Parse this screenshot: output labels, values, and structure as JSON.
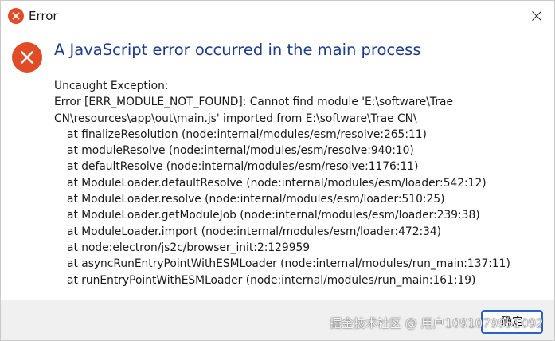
{
  "window": {
    "title": "Error"
  },
  "dialog": {
    "heading": "A JavaScript error occurred in the main process",
    "message_lines": [
      "Uncaught Exception:",
      "Error [ERR_MODULE_NOT_FOUND]: Cannot find module 'E:\\software\\Trae",
      "CN\\resources\\app\\out\\main.js' imported from E:\\software\\Trae CN\\"
    ],
    "stack_lines": [
      "at finalizeResolution (node:internal/modules/esm/resolve:265:11)",
      "at moduleResolve (node:internal/modules/esm/resolve:940:10)",
      "at defaultResolve (node:internal/modules/esm/resolve:1176:11)",
      "at ModuleLoader.defaultResolve (node:internal/modules/esm/loader:542:12)",
      "at ModuleLoader.resolve (node:internal/modules/esm/loader:510:25)",
      "at ModuleLoader.getModuleJob (node:internal/modules/esm/loader:239:38)",
      "at ModuleLoader.import (node:internal/modules/esm/loader:472:34)",
      "at node:electron/js2c/browser_init:2:129959",
      "at asyncRunEntryPointWithESMLoader (node:internal/modules/run_main:137:11)",
      "at runEntryPointWithESMLoader (node:internal/modules/run_main:161:19)"
    ],
    "ok_label": "确定"
  },
  "watermark": {
    "text": "掘金技术社区 @ 用户1091079951092"
  },
  "icons": {
    "title_icon": "error-icon",
    "dialog_icon": "error-icon",
    "close_icon": "close-icon"
  },
  "colors": {
    "error_red": "#e04b28",
    "heading_blue": "#1c3c8c",
    "button_border": "#2a63c7",
    "footer_bg": "#f0f0f0"
  }
}
